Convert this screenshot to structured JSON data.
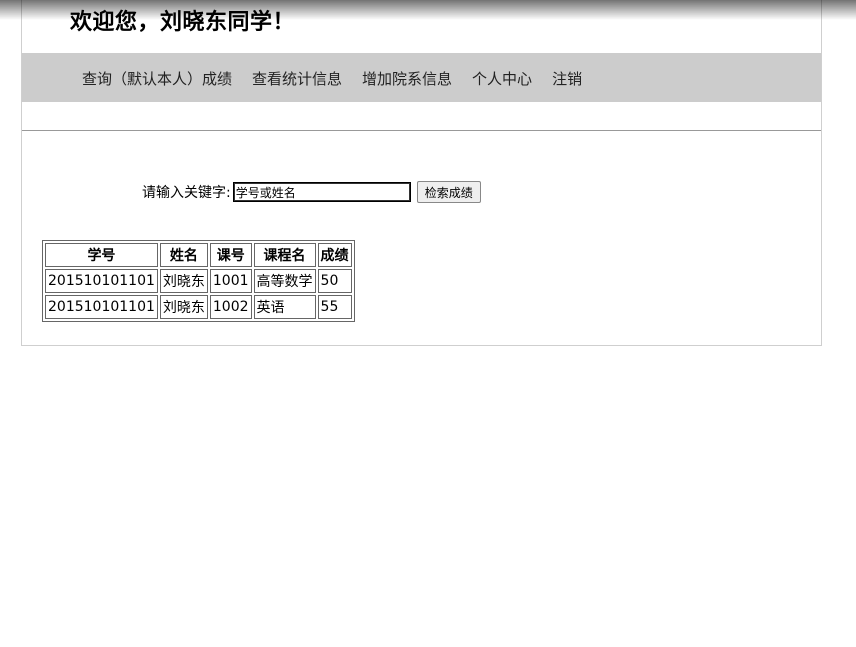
{
  "header": {
    "welcome": "欢迎您，刘晓东同学！"
  },
  "nav": {
    "items": [
      {
        "label": "查询（默认本人）成绩"
      },
      {
        "label": "查看统计信息"
      },
      {
        "label": "增加院系信息"
      },
      {
        "label": "个人中心"
      },
      {
        "label": "注销"
      }
    ]
  },
  "search": {
    "label": "请输入关键字:",
    "value": "学号或姓名",
    "button_label": "检索成绩"
  },
  "table": {
    "columns": [
      "学号",
      "姓名",
      "课号",
      "课程名",
      "成绩"
    ],
    "rows": [
      [
        "201510101101",
        "刘晓东",
        "1001",
        "高等数学",
        "50"
      ],
      [
        "201510101101",
        "刘晓东",
        "1002",
        "英语",
        "55"
      ]
    ]
  }
}
